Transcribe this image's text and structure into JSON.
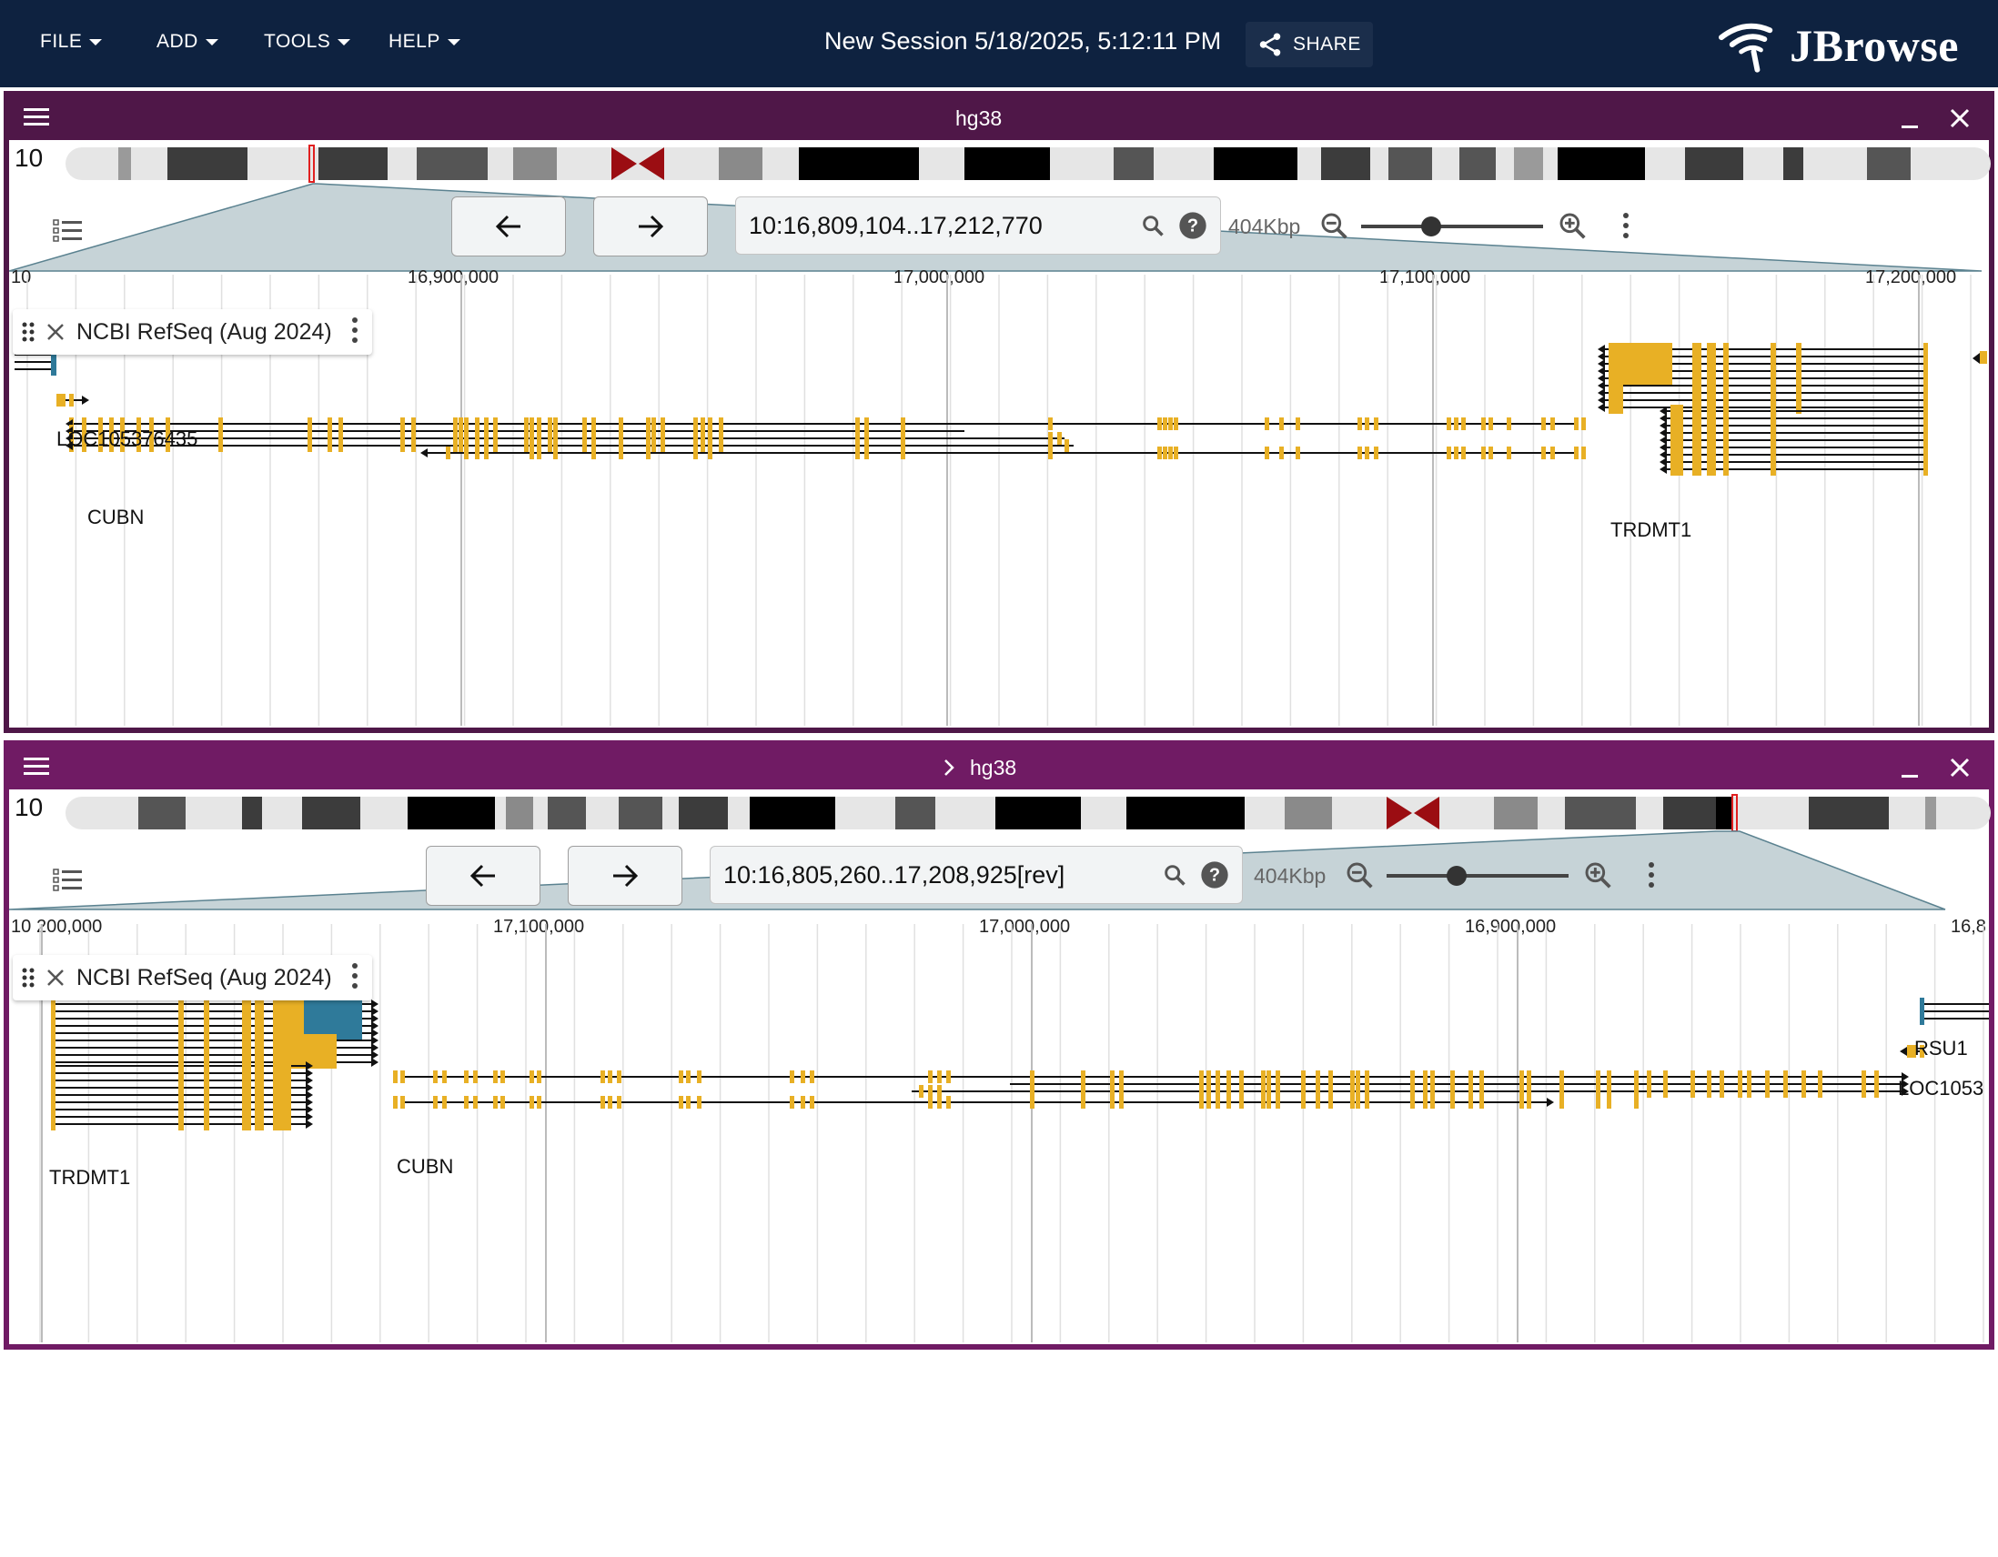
{
  "appbar": {
    "menus": [
      "FILE",
      "ADD",
      "TOOLS",
      "HELP"
    ],
    "session_title": "New Session 5/18/2025, 5:12:11 PM",
    "share_label": "SHARE",
    "logo_text": "JBrowse"
  },
  "views": [
    {
      "title": "hg38",
      "chromosome": "10",
      "location": "10:16,809,104..17,212,770",
      "zoom_label": "404Kbp",
      "ruler_start": "10",
      "ticks": [
        "16,900,000",
        "17,000,000",
        "17,100,000",
        "17,200,000"
      ],
      "track": "NCBI RefSeq (Aug 2024)",
      "genes": [
        "LOC105376435",
        "CUBN",
        "TRDMT1"
      ]
    },
    {
      "title": "hg38",
      "chromosome": "10",
      "location": "10:16,805,260..17,208,925[rev]",
      "zoom_label": "404Kbp",
      "ruler_start": "10",
      "ticks": [
        "200,000",
        "17,100,000",
        "17,000,000",
        "16,900,000",
        "16,8"
      ],
      "track": "NCBI RefSeq (Aug 2024)",
      "genes": [
        "TRDMT1",
        "CUBN",
        "RSU1",
        "LOC1053"
      ]
    }
  ],
  "colors": {
    "appbar": "#0e2240",
    "view1_header": "#4f1748",
    "view2_header": "#701b64",
    "exon": "#e8b025",
    "utr": "#2f7a9a",
    "centromere": "#8b0000"
  }
}
